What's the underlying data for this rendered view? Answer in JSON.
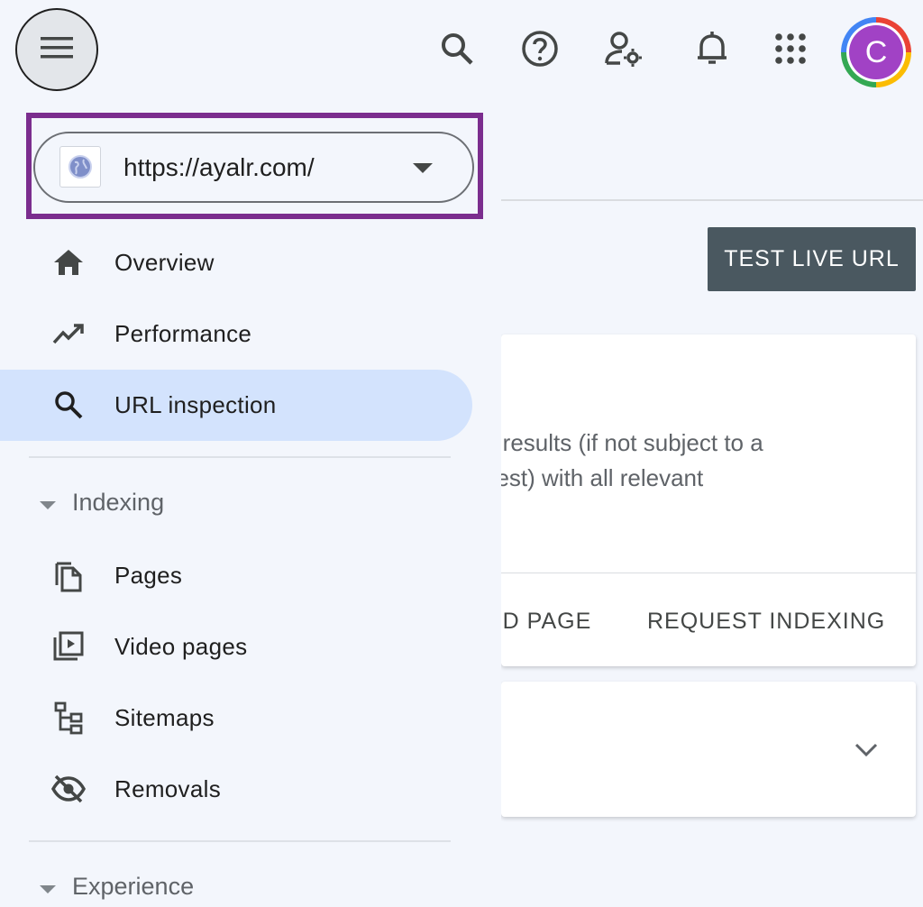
{
  "property": {
    "url": "https://ayalr.com/"
  },
  "nav": {
    "overview": "Overview",
    "performance": "Performance",
    "url_inspection": "URL inspection",
    "indexing": "Indexing",
    "pages": "Pages",
    "video_pages": "Video pages",
    "sitemaps": "Sitemaps",
    "removals": "Removals",
    "experience": "Experience"
  },
  "avatar": {
    "initial": "C"
  },
  "main": {
    "test_live_url": "TEST LIVE URL",
    "description_line1": "n results (if not subject to a",
    "description_line2": "uest) with all relevant",
    "view_crawled_page": "ED PAGE",
    "request_indexing": "REQUEST INDEXING"
  },
  "colors": {
    "highlight": "#7b2d8e",
    "active_nav": "#d3e3fd",
    "button": "#4a5860",
    "avatar": "#a142c5"
  }
}
